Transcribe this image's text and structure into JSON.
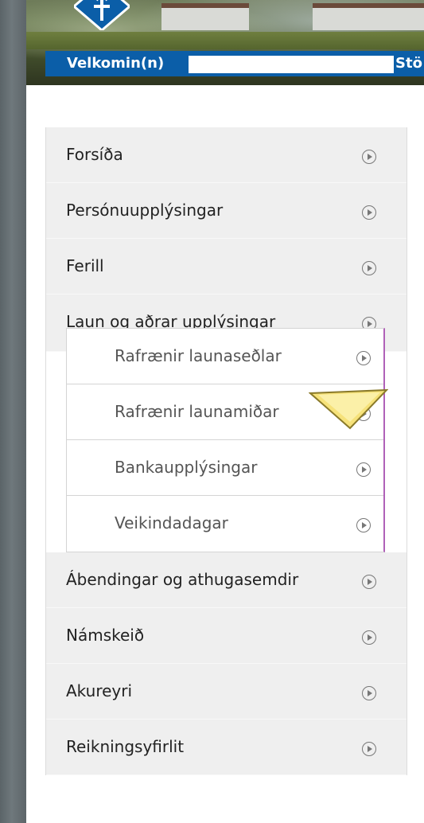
{
  "header": {
    "welcome_label": "Velkomin(n)",
    "welcome_suffix": "Stö"
  },
  "menu": {
    "items": [
      {
        "label": "Forsíða"
      },
      {
        "label": "Persónuupplýsingar"
      },
      {
        "label": "Ferill"
      },
      {
        "label": "Laun og aðrar upplýsingar"
      }
    ],
    "submenu": [
      {
        "label": "Rafrænir launaseðlar"
      },
      {
        "label": "Rafrænir launamiðar"
      },
      {
        "label": "Bankaupplýsingar"
      },
      {
        "label": "Veikindadagar"
      }
    ],
    "items_after": [
      {
        "label": "Ábendingar og athugasemdir"
      },
      {
        "label": "Námskeið"
      },
      {
        "label": "Akureyri"
      },
      {
        "label": "Reikningsyfirlit"
      }
    ]
  },
  "colors": {
    "brand_blue": "#0b5ea8",
    "submenu_accent": "#b061b8",
    "cursor_yellow": "#f6e27a"
  },
  "icons": {
    "menu_arrow": "circle-play-icon",
    "logo": "logo-icon",
    "pointer": "pointer-arrow-icon"
  }
}
